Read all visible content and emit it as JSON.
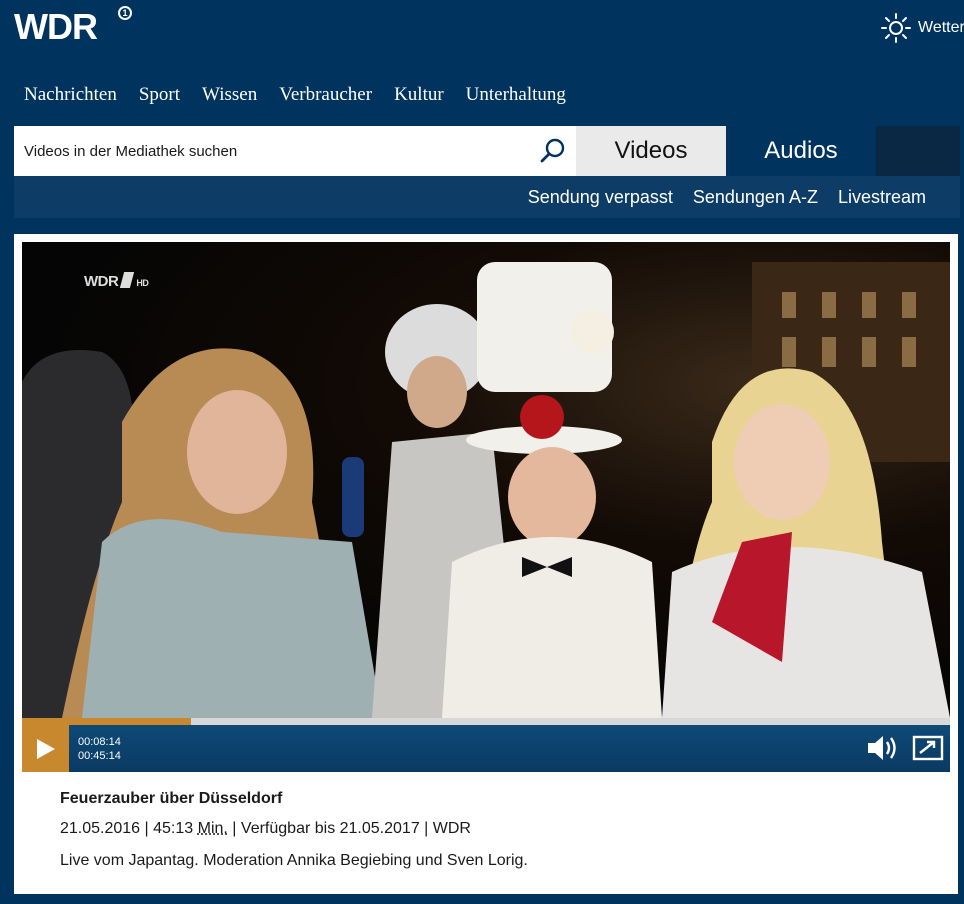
{
  "header": {
    "logo": "WDR",
    "logo_badge": "1",
    "weather_label": "Wetter"
  },
  "nav": {
    "items": [
      "Nachrichten",
      "Sport",
      "Wissen",
      "Verbraucher",
      "Kultur",
      "Unterhaltung"
    ]
  },
  "search": {
    "placeholder": "Videos in der Mediathek suchen"
  },
  "tabs": {
    "videos": "Videos",
    "audios": "Audios"
  },
  "subnav": {
    "items": [
      "Sendung verpasst",
      "Sendungen A-Z",
      "Livestream"
    ]
  },
  "player": {
    "channel_bug": "WDR",
    "channel_bug_hd": "HD",
    "current_time": "00:08:14",
    "duration": "00:45:14",
    "progress_fraction": 0.182
  },
  "episode": {
    "title": "Feuerzauber über Düsseldorf",
    "date": "21.05.2016",
    "length": "45:13",
    "length_unit": "Min.",
    "availability": "Verfügbar bis 21.05.2017",
    "broadcaster": "WDR",
    "description": "Live vom Japantag. Moderation Annika Begiebing und Sven Lorig."
  },
  "colors": {
    "background": "#00345e",
    "accent": "#c8882e",
    "controls": "#0e4a77"
  }
}
